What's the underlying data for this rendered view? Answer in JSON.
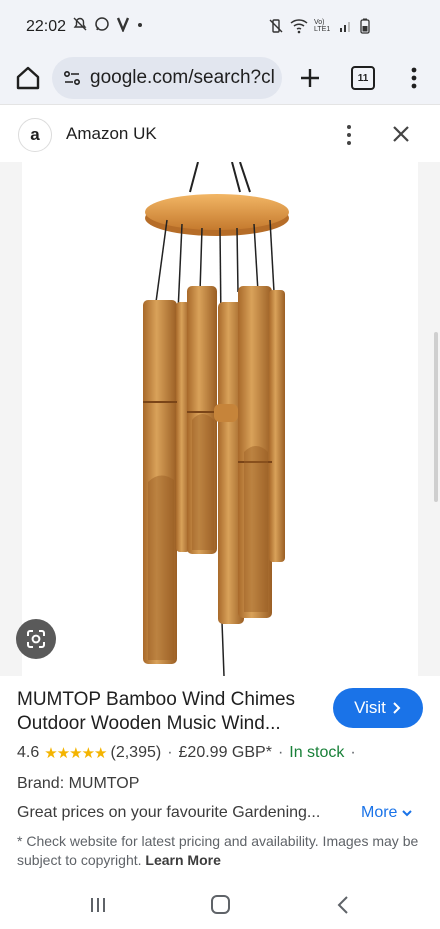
{
  "status_bar": {
    "time": "22:02",
    "left_icons": [
      "mute-notifications-icon",
      "whatsapp-icon",
      "v-app-icon",
      "dot-icon"
    ],
    "right_icons": [
      "vibrate-icon",
      "wifi-icon",
      "volte-icon",
      "signal-icon",
      "battery-icon"
    ],
    "volte_text": "Vo) LTE1"
  },
  "browser": {
    "url": "google.com/search?cl",
    "tab_count": "11"
  },
  "panel": {
    "source_logo": "a",
    "source_name": "Amazon UK"
  },
  "product": {
    "title": "MUMTOP Bamboo Wind Chimes Outdoor Wooden Music Wind...",
    "visit_label": "Visit",
    "rating": "4.6",
    "stars": "★★★★★",
    "review_count": "(2,395)",
    "price": "£20.99 GBP*",
    "stock": "In stock",
    "brand": "Brand: MUMTOP",
    "description": "Great prices on your favourite Gardening...",
    "more_label": "More",
    "disclaimer": "* Check website for latest pricing and availability. Images may be subject to copyright.",
    "learn_more": "Learn More"
  },
  "colors": {
    "accent": "#1a73e8",
    "stock_green": "#188038",
    "star": "#f4b400",
    "bamboo": "#c98a3e"
  }
}
